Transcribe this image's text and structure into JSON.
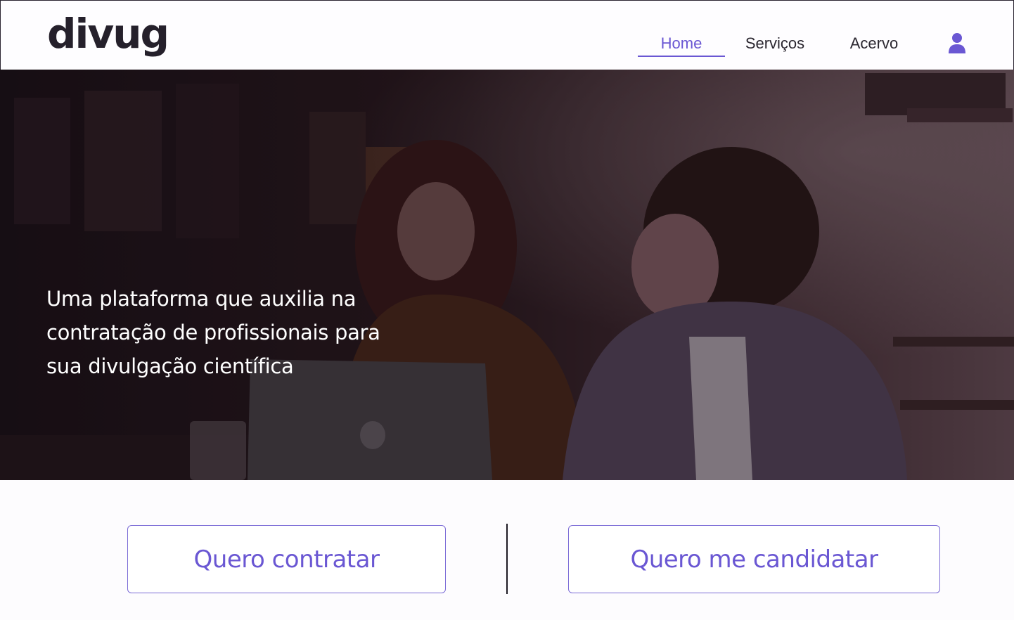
{
  "header": {
    "logo": "divug",
    "nav": [
      {
        "label": "Home",
        "active": true
      },
      {
        "label": "Serviços",
        "active": false
      },
      {
        "label": "Acervo",
        "active": false
      }
    ],
    "user_icon": "user-icon"
  },
  "hero": {
    "headline": "Uma plataforma que auxilia na contratação de profissionais para sua divulgação científica",
    "scroll_icon": "chevron-down-icon"
  },
  "cta": {
    "hire_label": "Quero contratar",
    "apply_label": "Quero me candidatar"
  },
  "colors": {
    "accent": "#6a57d3",
    "text": "#1e1a24",
    "background": "#fdfcfe"
  }
}
